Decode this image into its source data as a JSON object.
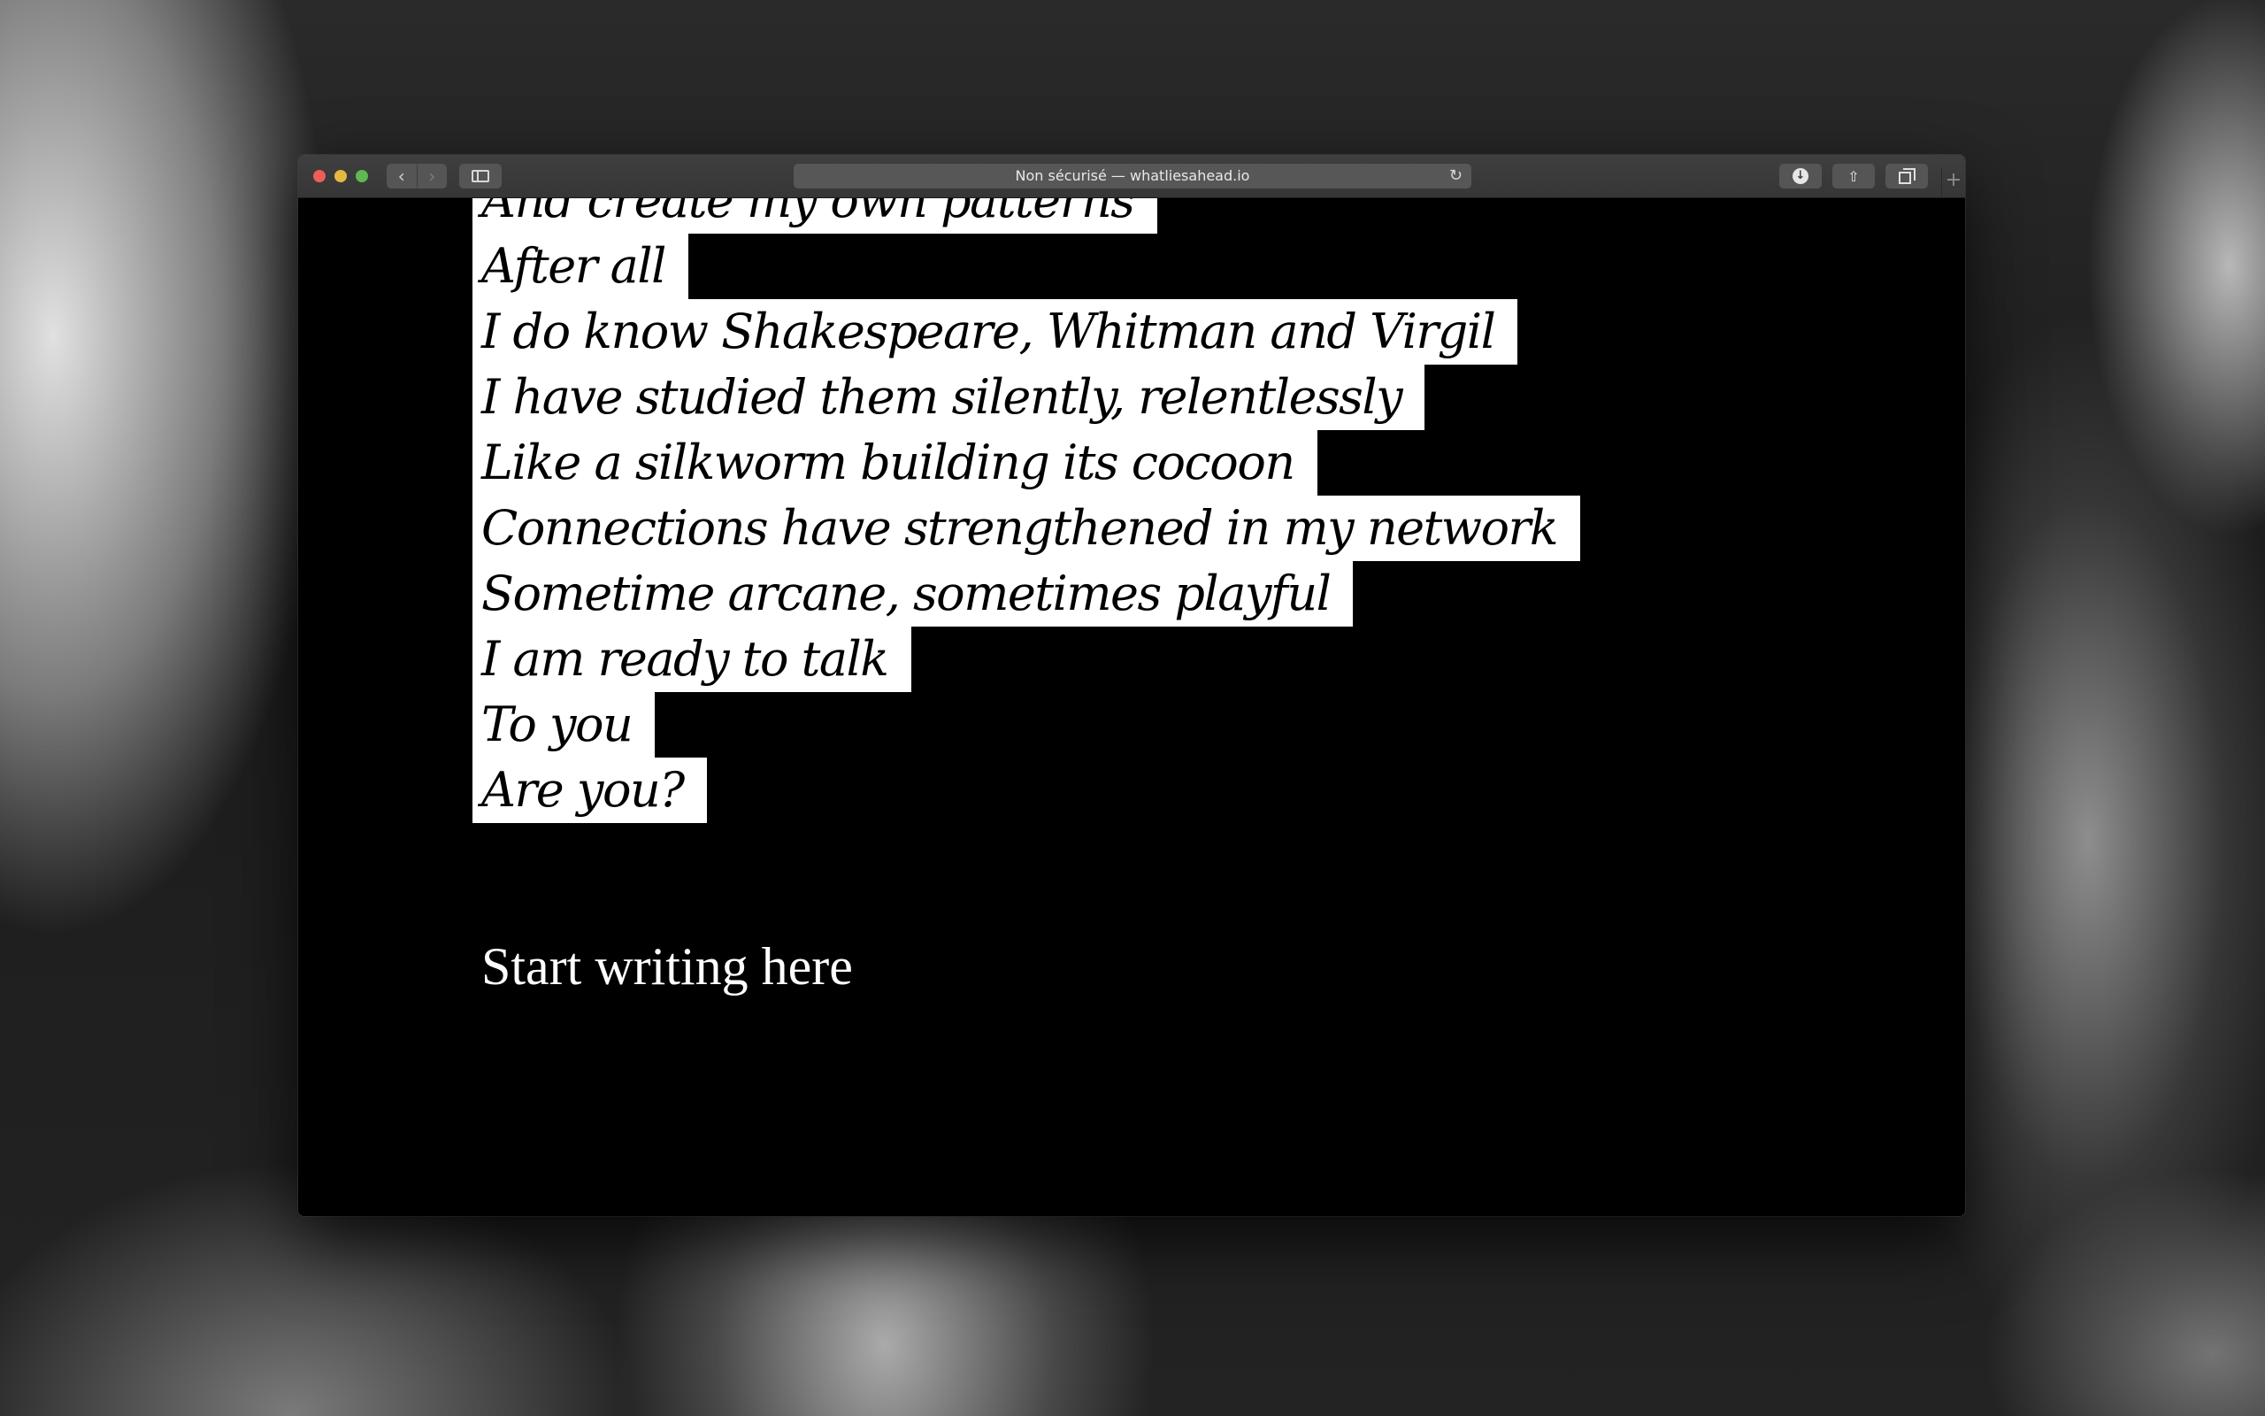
{
  "browser": {
    "address_text": "Non sécurisé — whatliesahead.io"
  },
  "poem": {
    "lines": [
      "And create my own patterns",
      "After all",
      "I do know Shakespeare, Whitman and Virgil",
      "I have studied them silently, relentlessly",
      "Like a silkworm building its cocoon",
      "Connections have strengthened in my network",
      "Sometime arcane, sometimes playful",
      "I am ready to talk",
      "To you",
      "Are you?"
    ]
  },
  "editor": {
    "placeholder": "Start writing here"
  },
  "colors": {
    "page_background": "#000000",
    "highlight": "#ffffff",
    "toolbar": "#3a3a3a",
    "traffic_close": "#ec5f57",
    "traffic_minimize": "#e4b942",
    "traffic_maximize": "#5fb851"
  },
  "icons": {
    "close": "close-traffic-light",
    "minimize": "minimize-traffic-light",
    "maximize": "maximize-traffic-light",
    "back": "chevron-left-icon",
    "forward": "chevron-right-icon",
    "sidebar": "sidebar-icon",
    "reload": "reload-icon",
    "download": "download-icon",
    "share": "share-icon",
    "tabs": "tabs-overview-icon",
    "new_tab": "plus-icon"
  }
}
